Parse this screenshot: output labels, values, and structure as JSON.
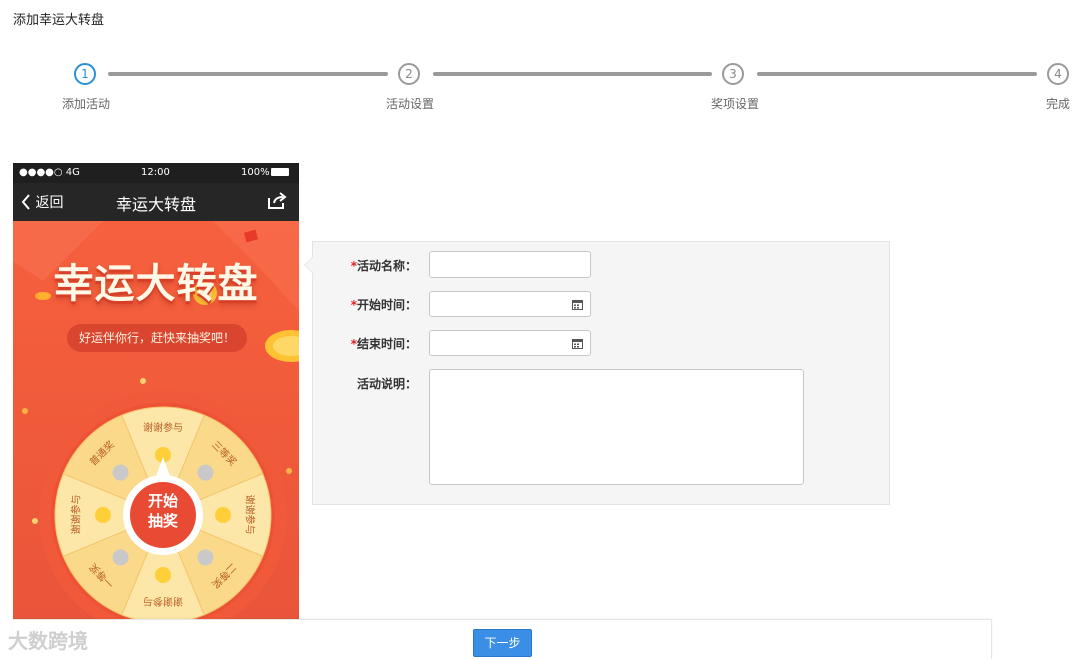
{
  "page": {
    "title": "添加幸运大转盘"
  },
  "steps": [
    {
      "number": "1",
      "label": "添加活动",
      "state": "active"
    },
    {
      "number": "2",
      "label": "活动设置",
      "state": "pending"
    },
    {
      "number": "3",
      "label": "奖项设置",
      "state": "pending"
    },
    {
      "number": "4",
      "label": "完成",
      "state": "pending"
    }
  ],
  "phone": {
    "status": {
      "signal": "●●●●○ 4G",
      "time": "12:00",
      "battery": "100%"
    },
    "nav": {
      "back": "返回",
      "title": "幸运大转盘"
    },
    "promo_title": "幸运大转盘",
    "promo_subtitle": "好运伴你行，赶快来抽奖吧！",
    "wheel": {
      "center": [
        "开始",
        "抽奖"
      ],
      "segments": [
        "谢谢参与",
        "三等奖",
        "谢谢参与",
        "二等奖",
        "谢谢参与",
        "一等奖",
        "谢谢参与",
        "普通奖"
      ]
    }
  },
  "form": {
    "name_label": "活动名称：",
    "start_label": "开始时间：",
    "end_label": "结束时间：",
    "desc_label": "活动说明：",
    "required_mark": "*",
    "name_value": "",
    "start_value": "",
    "end_value": "",
    "desc_value": ""
  },
  "footer": {
    "next_label": "下一步",
    "watermark": "大数跨境"
  },
  "colors": {
    "accent": "#3a8ee6",
    "active_step": "#2a8fd8",
    "required": "#e02020",
    "promo_bg": "#f25e3d"
  },
  "icons": [
    "calendar-icon",
    "share-icon",
    "chevron-left-icon"
  ]
}
